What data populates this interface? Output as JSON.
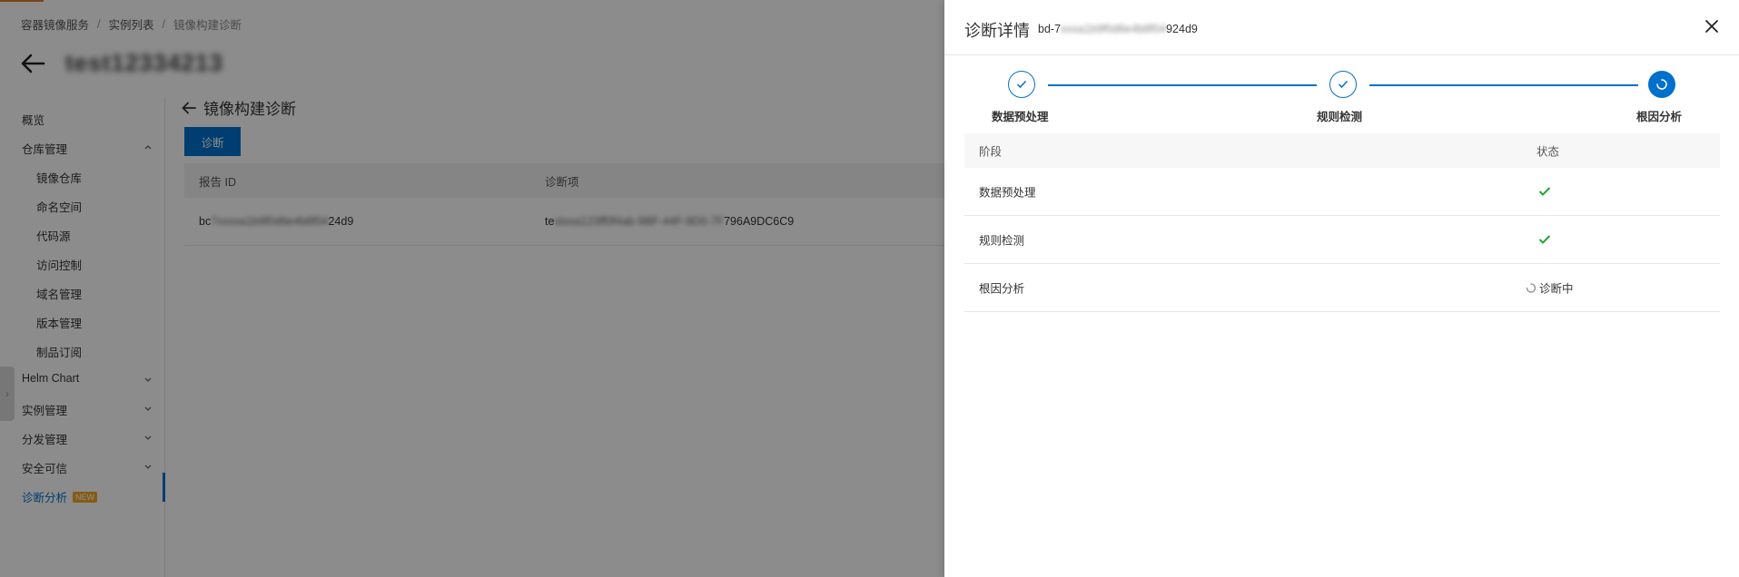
{
  "breadcrumb": {
    "item1": "容器镜像服务",
    "item2": "实例列表",
    "current": "镜像构建诊断"
  },
  "instance": {
    "name": "test12334213"
  },
  "sidebar": {
    "overview": "概览",
    "repo_mgmt": "仓库管理",
    "image_repo": "镜像仓库",
    "namespace": "命名空间",
    "code_source": "代码源",
    "access_control": "访问控制",
    "domain_mgmt": "域名管理",
    "version_mgmt": "版本管理",
    "artifact_sub": "制品订阅",
    "helm_chart": "Helm Chart",
    "instance_mgmt": "实例管理",
    "distribution_mgmt": "分发管理",
    "security_trust": "安全可信",
    "diagnosis": "诊断分析",
    "new_badge": "NEW"
  },
  "main": {
    "title": "镜像构建诊断",
    "diagnose_button": "诊断",
    "table": {
      "col_report_id": "报告 ID",
      "col_item": "诊断项",
      "row_report_prefix": "bc",
      "row_report_mid": "7xxxxa1b9f0d6e4b8f04",
      "row_report_suffix": "24d9",
      "row_item_prefix": "te",
      "row_item_mid": "stxxa123ff0f4ab-9BF-44F-9D0-7F",
      "row_item_suffix": "796A9DC6C9"
    }
  },
  "drawer": {
    "title": "诊断详情",
    "report_id_prefix": "bd-7",
    "report_id_mid": "xxxa1b9f0d6e4b8f04",
    "report_id_suffix": "924d9",
    "steps": [
      {
        "label": "数据预处理",
        "state": "done"
      },
      {
        "label": "规则检测",
        "state": "done"
      },
      {
        "label": "根因分析",
        "state": "active"
      }
    ],
    "table": {
      "col_stage": "阶段",
      "col_status": "状态",
      "rows": [
        {
          "stage": "数据预处理",
          "status": "success"
        },
        {
          "stage": "规则检测",
          "status": "success"
        },
        {
          "stage": "根因分析",
          "status": "running",
          "status_text": "诊断中"
        }
      ]
    }
  },
  "colors": {
    "primary": "#0070cc",
    "success": "#1aa834",
    "badge": "#f5a623"
  }
}
